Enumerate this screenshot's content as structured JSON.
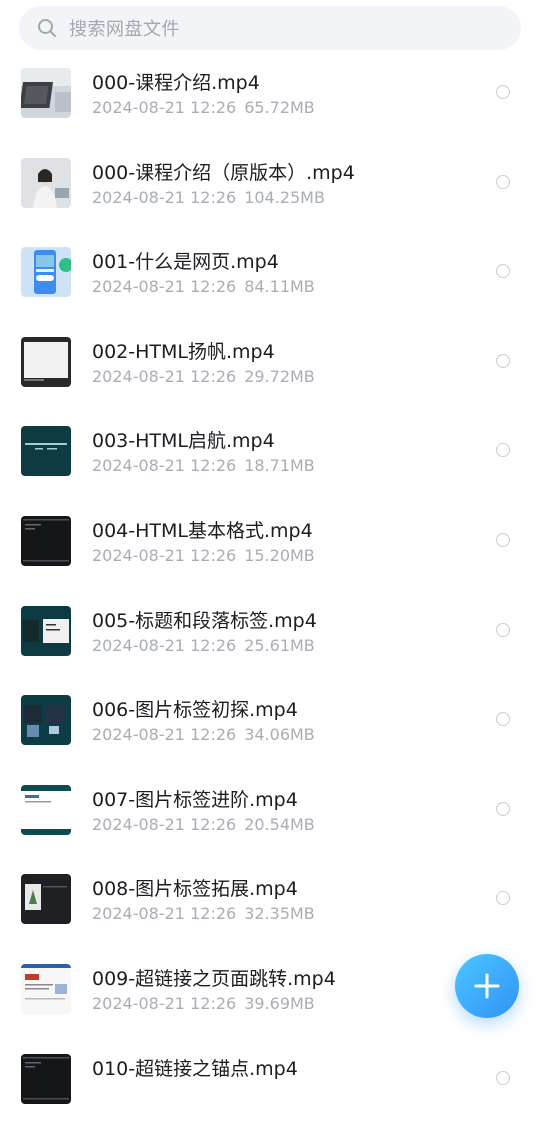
{
  "search": {
    "placeholder": "搜索网盘文件"
  },
  "files": [
    {
      "name": "000-课程介绍.mp4",
      "date": "2024-08-21",
      "time": "12:26",
      "size": "65.72MB",
      "thumb": "laptop"
    },
    {
      "name": "000-课程介绍（原版本）.mp4",
      "date": "2024-08-21",
      "time": "12:26",
      "size": "104.25MB",
      "thumb": "person"
    },
    {
      "name": "001-什么是网页.mp4",
      "date": "2024-08-21",
      "time": "12:26",
      "size": "84.11MB",
      "thumb": "phone"
    },
    {
      "name": "002-HTML扬帆.mp4",
      "date": "2024-08-21",
      "time": "12:26",
      "size": "29.72MB",
      "thumb": "white-screen"
    },
    {
      "name": "003-HTML启航.mp4",
      "date": "2024-08-21",
      "time": "12:26",
      "size": "18.71MB",
      "thumb": "teal-text"
    },
    {
      "name": "004-HTML基本格式.mp4",
      "date": "2024-08-21",
      "time": "12:26",
      "size": "15.20MB",
      "thumb": "dark-code"
    },
    {
      "name": "005-标题和段落标签.mp4",
      "date": "2024-08-21",
      "time": "12:26",
      "size": "25.61MB",
      "thumb": "teal-panel"
    },
    {
      "name": "006-图片标签初探.mp4",
      "date": "2024-08-21",
      "time": "12:26",
      "size": "34.06MB",
      "thumb": "teal-images"
    },
    {
      "name": "007-图片标签进阶.mp4",
      "date": "2024-08-21",
      "time": "12:26",
      "size": "20.54MB",
      "thumb": "white-web"
    },
    {
      "name": "008-图片标签拓展.mp4",
      "date": "2024-08-21",
      "time": "12:26",
      "size": "32.35MB",
      "thumb": "dark-image"
    },
    {
      "name": "009-超链接之页面跳转.mp4",
      "date": "2024-08-21",
      "time": "12:26",
      "size": "39.69MB",
      "thumb": "news-page"
    },
    {
      "name": "010-超链接之锚点.mp4",
      "date": "",
      "time": "",
      "size": "",
      "thumb": "dark-code"
    }
  ]
}
